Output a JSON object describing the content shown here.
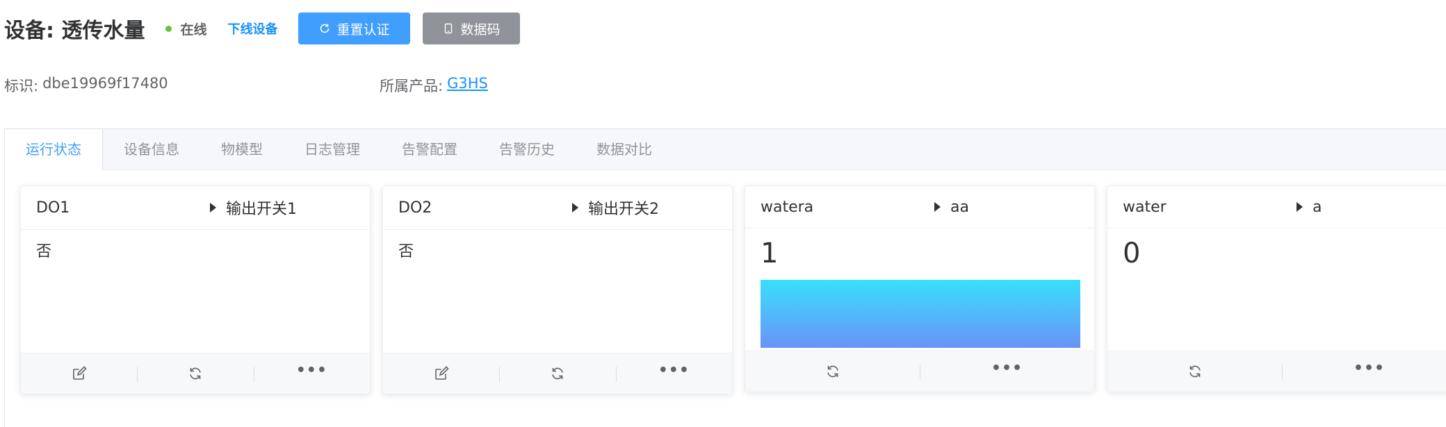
{
  "header": {
    "title": "设备: 透传水量",
    "status": "在线",
    "offline_link": "下线设备",
    "reset_button": "重置认证",
    "qr_button": "数据码"
  },
  "meta": {
    "id_label": "标识:",
    "id_value": "dbe19969f17480",
    "product_label": "所属产品:",
    "product_value": "G3HS"
  },
  "tabs": [
    {
      "label": "运行状态",
      "active": true
    },
    {
      "label": "设备信息"
    },
    {
      "label": "物模型"
    },
    {
      "label": "日志管理"
    },
    {
      "label": "告警配置"
    },
    {
      "label": "告警历史"
    },
    {
      "label": "数据对比"
    }
  ],
  "cards": [
    {
      "name": "DO1",
      "property": "输出开关1",
      "value": "否"
    },
    {
      "name": "DO2",
      "property": "输出开关2",
      "value": "否"
    },
    {
      "name": "watera",
      "property": "aa",
      "value": "1"
    },
    {
      "name": "water",
      "property": "a",
      "value": "0"
    }
  ],
  "colors": {
    "primary": "#409eff",
    "online": "#67c23a",
    "link": "#1890ff",
    "qr_button": "#909399",
    "gauge_top": "#38e0fb",
    "gauge_bottom": "#6b92f9"
  },
  "icons": {
    "reset": "refresh-icon",
    "qr": "phone-icon",
    "edit": "edit-icon",
    "refresh": "refresh-icon",
    "more": "more-icon"
  }
}
